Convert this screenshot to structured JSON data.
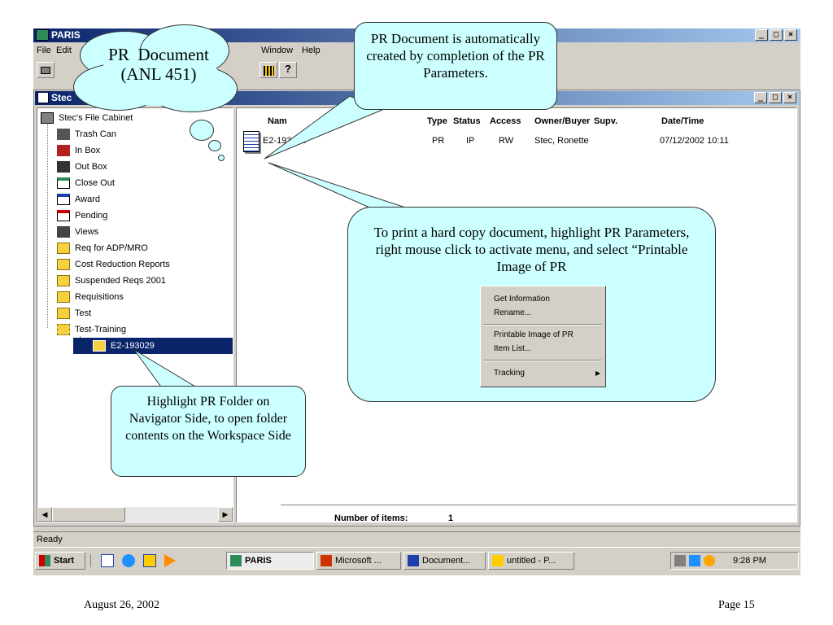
{
  "app": {
    "title": "PARIS"
  },
  "menu": [
    "File",
    "Edit",
    "Window",
    "Help"
  ],
  "window_controls": [
    "_",
    "□",
    "×"
  ],
  "navigator": {
    "title": "Stec",
    "root": "Stec's File Cabinet",
    "items": [
      "Trash Can",
      "In Box",
      "Out Box",
      "Close Out",
      "Award",
      "Pending",
      "Views",
      "Req for ADP/MRO",
      "Cost Reduction Reports",
      "Suspended Reqs 2001",
      "Requisitions",
      "Test",
      "Test-Training"
    ],
    "selected": "E2-193029"
  },
  "workspace": {
    "columns": [
      "Nam",
      "Type",
      "Status",
      "Access",
      "Owner/Buyer",
      "Supv.",
      "Date/Time"
    ],
    "row": {
      "name": "E2-193029",
      "type": "PR",
      "status": "IP",
      "access": "RW",
      "owner": "Stec, Ronette",
      "date": "07/12/2002 10:11"
    },
    "items_label": "Number of items:",
    "items_count": "1"
  },
  "context_menu": {
    "group1": [
      "Get Information",
      "Rename..."
    ],
    "group2": [
      "Printable Image of PR",
      "Item List..."
    ],
    "group3": [
      "Tracking"
    ]
  },
  "status": "Ready",
  "taskbar": {
    "start": "Start",
    "tasks": [
      "PARIS",
      "Microsoft ...",
      "Document...",
      "untitled - P..."
    ],
    "clock": "9:28 PM"
  },
  "callouts": {
    "cloud_line1": "PR  Document",
    "cloud_line2": "(ANL 451)",
    "top": "PR Document is automatically created by completion of the PR Parameters.",
    "print": "To print a hard copy document, highlight PR Parameters, right mouse click to activate menu, and select “Printable Image of PR",
    "highlight": "Highlight PR Folder on Navigator Side, to open folder contents on the Workspace Side"
  },
  "footer": {
    "date": "August 26, 2002",
    "page": "Page 15"
  },
  "colors": {
    "title_start": "#0a246a",
    "title_end": "#a6caf0",
    "selection": "#0a246a",
    "callout_fill": "#ccffff",
    "chrome": "#d4d0c8"
  }
}
